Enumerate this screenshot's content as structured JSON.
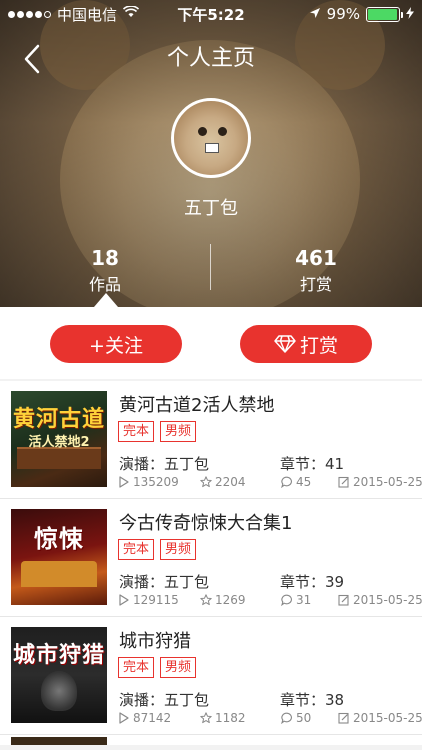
{
  "status_bar": {
    "carrier": "中国电信",
    "time": "下午5:22",
    "battery": "99%",
    "battery_level": 0.99,
    "signal_bars": 4
  },
  "header": {
    "back_icon": "chevron-left-icon",
    "title": "个人主页"
  },
  "profile": {
    "username": "五丁包",
    "stats": [
      {
        "value": "18",
        "label": "作品"
      },
      {
        "value": "461",
        "label": "打赏"
      }
    ],
    "active_tab_index": 0
  },
  "actions": {
    "follow_label": "+关注",
    "tip_label": "打赏",
    "tip_icon": "diamond-icon",
    "accent_color": "#e8332e"
  },
  "works": [
    {
      "title": "黄河古道2活人禁地",
      "cover_title": "黄河古道",
      "cover_subtitle": "活人禁地2",
      "tags": [
        "完本",
        "男频"
      ],
      "narrator_label": "演播：",
      "narrator": "五丁包",
      "chapters_label": "章节：",
      "chapters": "41",
      "plays": "135209",
      "favorites": "2204",
      "comments": "45",
      "date": "2015-05-25"
    },
    {
      "title": "今古传奇惊悚大合集1",
      "cover_title": "惊悚",
      "cover_subtitle": "",
      "tags": [
        "完本",
        "男频"
      ],
      "narrator_label": "演播：",
      "narrator": "五丁包",
      "chapters_label": "章节：",
      "chapters": "39",
      "plays": "129115",
      "favorites": "1269",
      "comments": "31",
      "date": "2015-05-25"
    },
    {
      "title": "城市狩猎",
      "cover_title": "城市狩猎",
      "cover_subtitle": "",
      "tags": [
        "完本",
        "男频"
      ],
      "narrator_label": "演播：",
      "narrator": "五丁包",
      "chapters_label": "章节：",
      "chapters": "38",
      "plays": "87142",
      "favorites": "1182",
      "comments": "50",
      "date": "2015-05-25"
    }
  ]
}
